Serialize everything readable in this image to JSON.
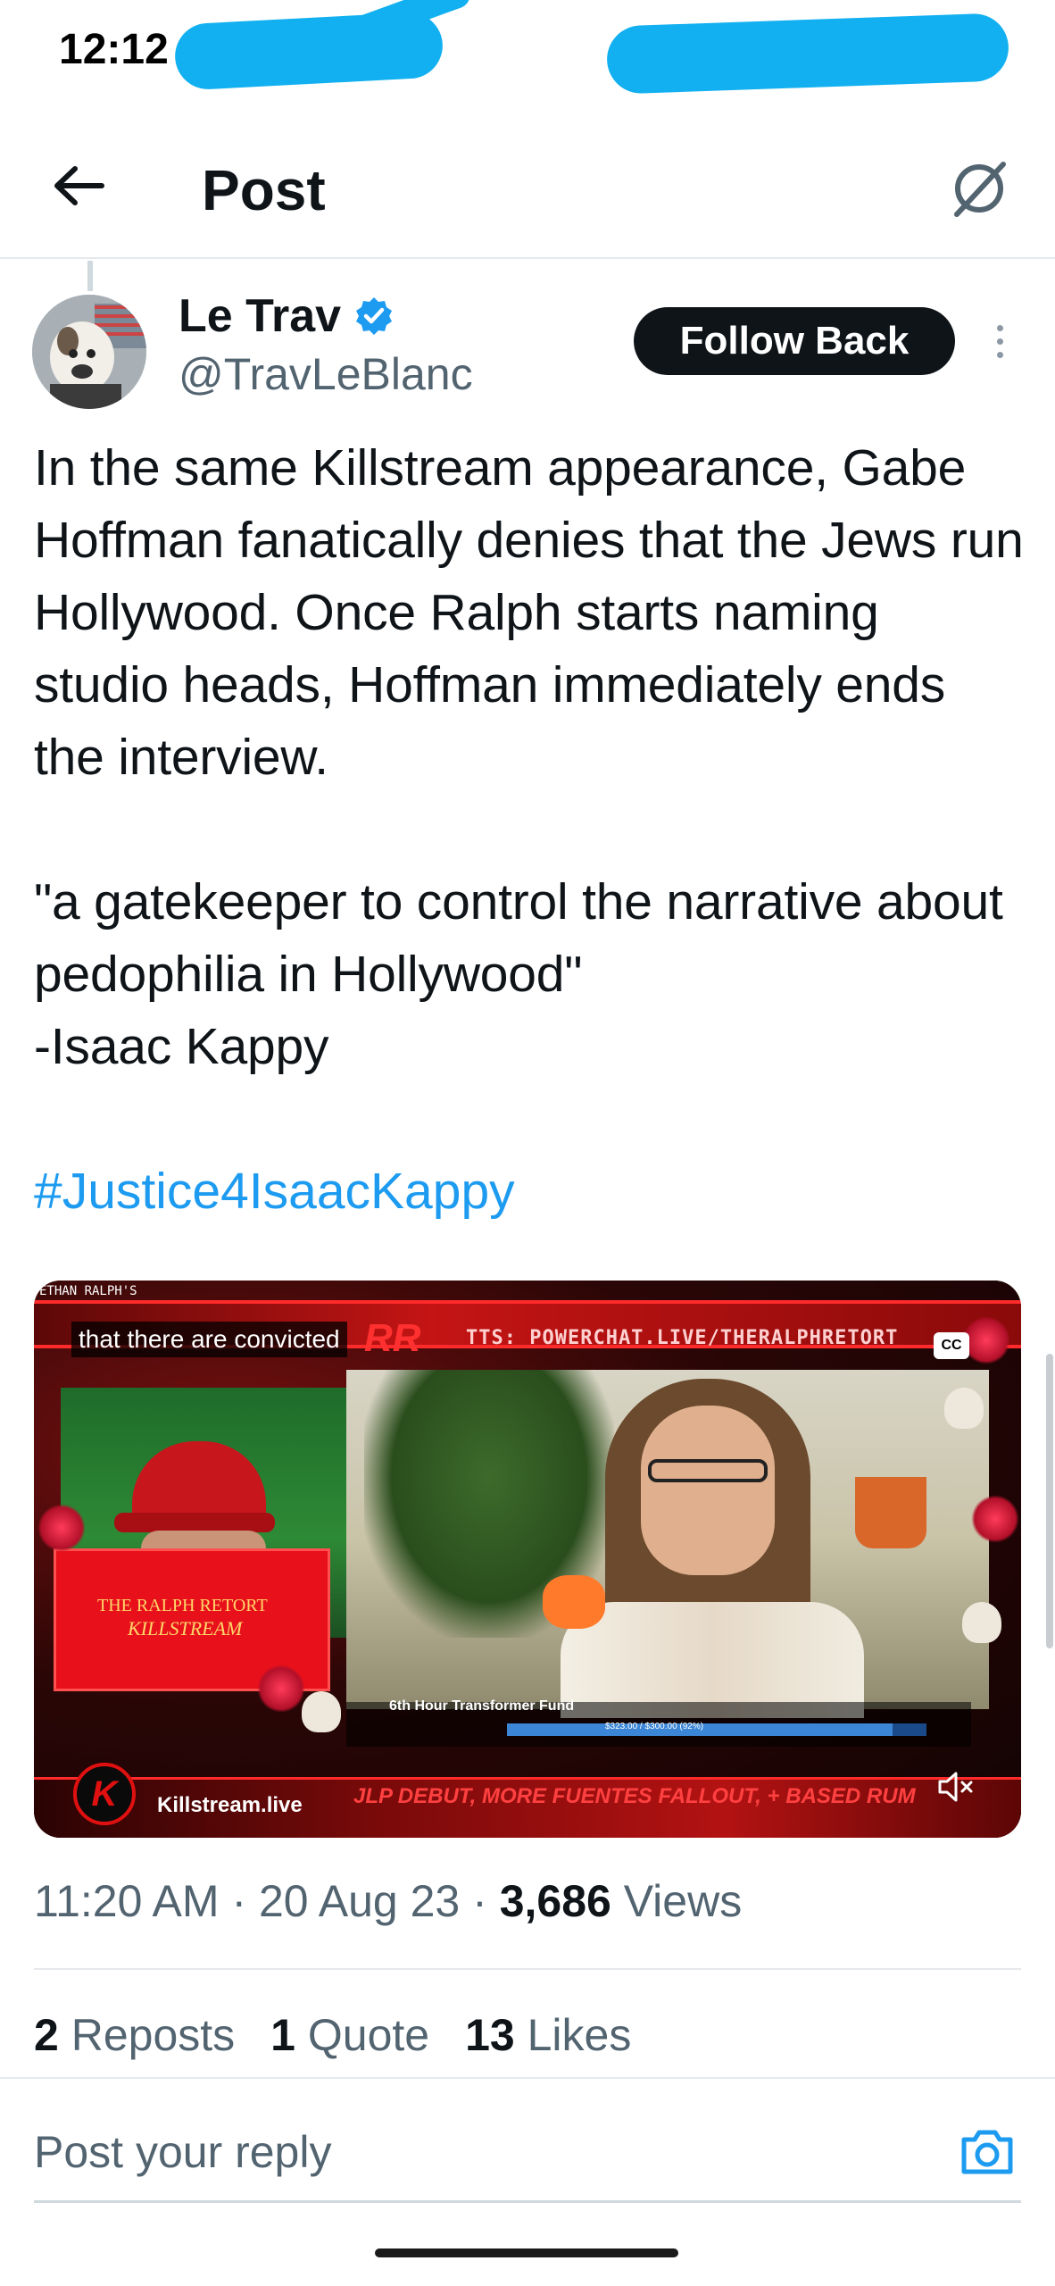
{
  "status_bar": {
    "time": "12:12"
  },
  "header": {
    "title": "Post"
  },
  "author": {
    "name": "Le Trav",
    "handle": "@TravLeBlanc",
    "follow_label": "Follow Back"
  },
  "post": {
    "text": "In the same Killstream appearance, Gabe Hoffman fanatically denies that the Jews run Hollywood. Once Ralph starts naming studio heads, Hoffman immediately ends the interview.\n\n\"a gatekeeper to control the narrative about pedophilia in Hollywood\"\n-Isaac Kappy",
    "hashtag": "#Justice4IsaacKappy"
  },
  "video": {
    "top_left_text": "ETHAN RALPH'S",
    "caption": "that there are convicted",
    "ticker": "TTS: POWERCHAT.LIVE/THERALPHRETORT",
    "cc_label": "CC",
    "card_line1": "THE RALPH RETORT",
    "card_line2": "KILLSTREAM",
    "fund_label": "6th Hour Transformer Fund",
    "fund_progress_pct": 92,
    "fund_amount": "$323.00 / $300.00 (92%)",
    "source": "Killstream.live",
    "scroll_text": "JLP DEBUT, MORE FUENTES FALLOUT, + BASED RUM",
    "logo_letter": "K"
  },
  "meta": {
    "time": "11:20 AM",
    "date": "20 Aug 23",
    "views_count": "3,686",
    "views_label": "Views"
  },
  "stats": {
    "reposts_count": "2",
    "reposts_label": "Reposts",
    "quotes_count": "1",
    "quotes_label": "Quote",
    "likes_count": "13",
    "likes_label": "Likes"
  },
  "reply": {
    "placeholder": "Post your reply"
  },
  "colors": {
    "accent": "#1d9bf0",
    "text_primary": "#0f1419",
    "text_secondary": "#536471",
    "redaction": "#12b0f0"
  }
}
